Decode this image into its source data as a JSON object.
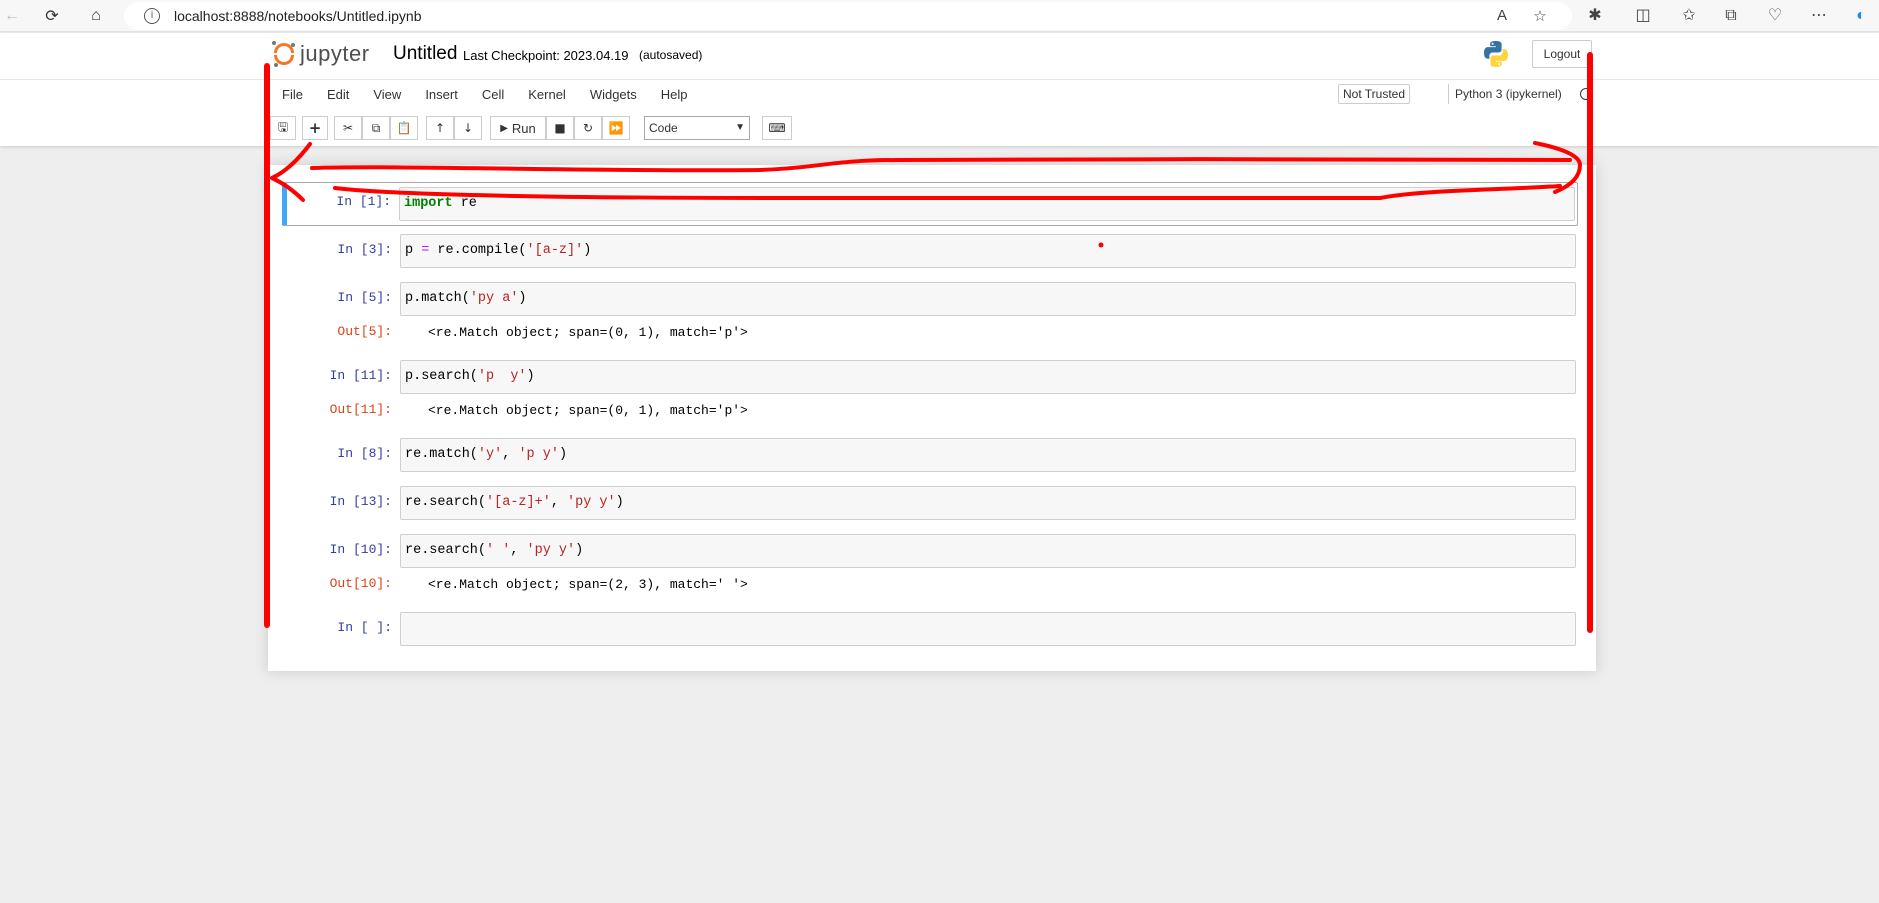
{
  "browser": {
    "url": "localhost:8888/notebooks/Untitled.ipynb",
    "info_glyph": "i"
  },
  "header": {
    "logo_text": "jupyter",
    "notebook_title": "Untitled",
    "checkpoint_label": "Last Checkpoint: 2023.04.19",
    "autosave_status": "(autosaved)",
    "logout_label": "Logout"
  },
  "menu": {
    "items": [
      "File",
      "Edit",
      "View",
      "Insert",
      "Cell",
      "Kernel",
      "Widgets",
      "Help"
    ],
    "trust_status": "Not Trusted",
    "kernel": "Python 3 (ipykernel)"
  },
  "toolbar": {
    "run_label": "Run",
    "cell_type": "Code"
  },
  "cells": [
    {
      "prompt": "In [1]:",
      "code": [
        {
          "t": "kw",
          "v": "import"
        },
        {
          "t": "plain",
          "v": " re"
        }
      ],
      "output_prompt": "",
      "output": ""
    },
    {
      "prompt": "In [3]:",
      "code": [
        {
          "t": "plain",
          "v": "p "
        },
        {
          "t": "op",
          "v": "="
        },
        {
          "t": "plain",
          "v": " re.compile("
        },
        {
          "t": "str",
          "v": "'[a-z]'"
        },
        {
          "t": "plain",
          "v": ")"
        }
      ],
      "output_prompt": "",
      "output": ""
    },
    {
      "prompt": "In [5]:",
      "code": [
        {
          "t": "plain",
          "v": "p.match("
        },
        {
          "t": "str",
          "v": "'py a'"
        },
        {
          "t": "plain",
          "v": ")"
        }
      ],
      "output_prompt": "Out[5]:",
      "output": "<re.Match object; span=(0, 1), match='p'>"
    },
    {
      "prompt": "In [11]:",
      "code": [
        {
          "t": "plain",
          "v": "p.search("
        },
        {
          "t": "str",
          "v": "'p  y'"
        },
        {
          "t": "plain",
          "v": ")"
        }
      ],
      "output_prompt": "Out[11]:",
      "output": "<re.Match object; span=(0, 1), match='p'>"
    },
    {
      "prompt": "In [8]:",
      "code": [
        {
          "t": "plain",
          "v": "re.match("
        },
        {
          "t": "str",
          "v": "'y'"
        },
        {
          "t": "plain",
          "v": ", "
        },
        {
          "t": "str",
          "v": "'p y'"
        },
        {
          "t": "plain",
          "v": ")"
        }
      ],
      "output_prompt": "",
      "output": ""
    },
    {
      "prompt": "In [13]:",
      "code": [
        {
          "t": "plain",
          "v": "re.search("
        },
        {
          "t": "str",
          "v": "'[a-z]+'"
        },
        {
          "t": "plain",
          "v": ", "
        },
        {
          "t": "str",
          "v": "'py y'"
        },
        {
          "t": "plain",
          "v": ")"
        }
      ],
      "output_prompt": "",
      "output": ""
    },
    {
      "prompt": "In [10]:",
      "code": [
        {
          "t": "plain",
          "v": "re.search("
        },
        {
          "t": "str",
          "v": "' '"
        },
        {
          "t": "plain",
          "v": ", "
        },
        {
          "t": "str",
          "v": "'py y'"
        },
        {
          "t": "plain",
          "v": ")"
        }
      ],
      "output_prompt": "Out[10]:",
      "output": "<re.Match object; span=(2, 3), match=' '>"
    },
    {
      "prompt": "In [ ]:",
      "code": [],
      "output_prompt": "",
      "output": ""
    }
  ],
  "colors": {
    "accent_orange": "#f37726",
    "selected_cell_border": "#42a5f5",
    "in_prompt": "#303f9f",
    "out_prompt": "#d84315",
    "annotation_red": "#ff0000"
  }
}
